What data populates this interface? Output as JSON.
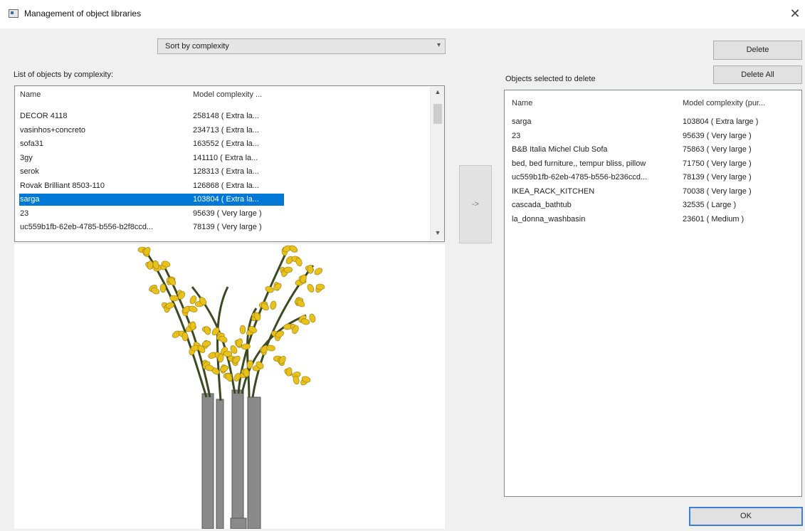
{
  "window": {
    "title": "Management of object libraries",
    "close_glyph": "✕"
  },
  "sort": {
    "value": "Sort by complexity",
    "arrow": "▾"
  },
  "buttons": {
    "delete": "Delete",
    "delete_all": "Delete All",
    "transfer": "->",
    "ok": "OK"
  },
  "left_list": {
    "label": "List of objects by complexity:",
    "headers": [
      "Name",
      "Model complexity ..."
    ],
    "rows": [
      {
        "name": "DECOR 4118",
        "complexity": "258148 ( Extra la..."
      },
      {
        "name": "vasinhos+concreto",
        "complexity": "234713 ( Extra la..."
      },
      {
        "name": "sofa31",
        "complexity": "163552 ( Extra la..."
      },
      {
        "name": "3gy",
        "complexity": "141110 ( Extra la..."
      },
      {
        "name": "serok",
        "complexity": "128313 ( Extra la..."
      },
      {
        "name": "Rovak Brilliant 8503-110",
        "complexity": "126868 ( Extra la..."
      },
      {
        "name": "sarga",
        "complexity": "103804 ( Extra la...",
        "selected": true
      },
      {
        "name": "23",
        "complexity": "95639 ( Very large )"
      },
      {
        "name": "uc559b1fb-62eb-4785-b556-b2f8ccd...",
        "complexity": "78139 ( Very large )"
      }
    ],
    "scroll_up": "▲",
    "scroll_down": "▼"
  },
  "right_list": {
    "label": "Objects selected to delete",
    "headers": [
      "Name",
      "Model complexity (pur..."
    ],
    "rows": [
      {
        "name": "sarga",
        "complexity": "103804 ( Extra large )"
      },
      {
        "name": "23",
        "complexity": "95639 ( Very large )"
      },
      {
        "name": "B&B Italia Michel Club Sofa",
        "complexity": "75863 ( Very large )"
      },
      {
        "name": "bed, bed furniture,, tempur bliss, pillow",
        "complexity": "71750 ( Very large )"
      },
      {
        "name": "uc559b1fb-62eb-4785-b556-b236ccd...",
        "complexity": "78139 ( Very large )"
      },
      {
        "name": "IKEA_RACK_KITCHEN",
        "complexity": "70038 ( Very large )"
      },
      {
        "name": "cascada_bathtub",
        "complexity": "32535 ( Large )"
      },
      {
        "name": "la_donna_washbasin",
        "complexity": "23601 ( Medium )"
      }
    ]
  },
  "colors": {
    "selection": "#0078d7",
    "flower": "#e8c21a",
    "stem": "#3a4a22",
    "vase": "#8a8a8a"
  }
}
